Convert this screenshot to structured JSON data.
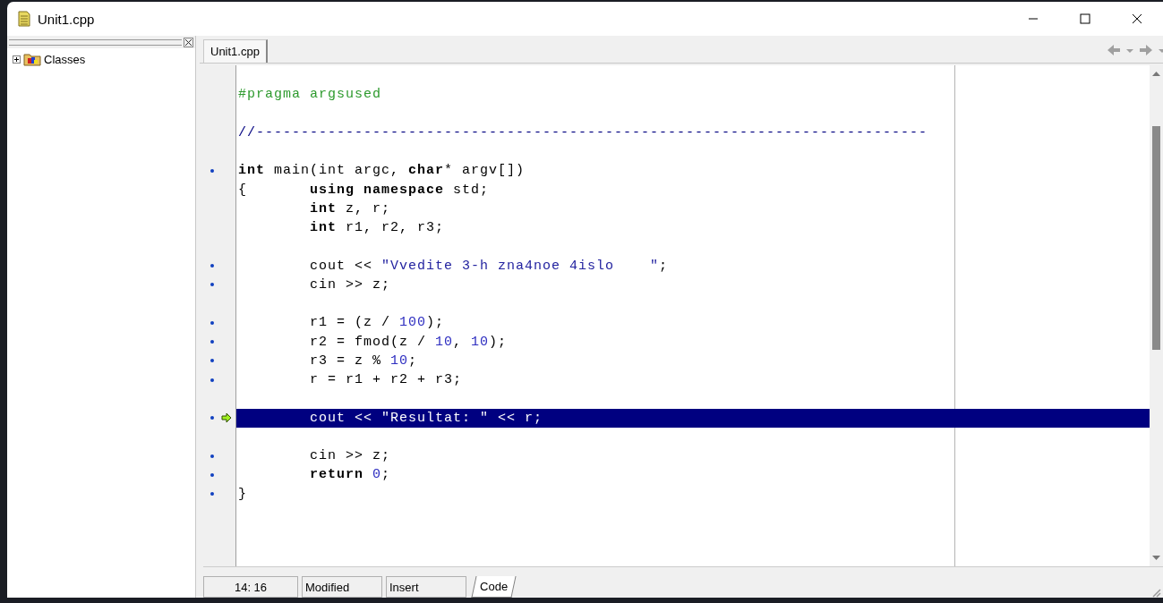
{
  "window": {
    "title": "Unit1.cpp"
  },
  "class_tree": {
    "items": [
      {
        "label": "Classes",
        "expanded": false
      }
    ]
  },
  "editor": {
    "tabs": [
      {
        "label": "Unit1.cpp",
        "selected": true
      }
    ],
    "lines": [
      {
        "dot": false,
        "current": false
      },
      {
        "dot": false,
        "current": false,
        "tokens": [
          {
            "kind": "directive",
            "text": "#pragma argsused"
          }
        ]
      },
      {
        "dot": false,
        "current": false
      },
      {
        "dot": false,
        "current": false,
        "tokens": [
          {
            "kind": "comment",
            "text": "//---------------------------------------------------------------------------"
          }
        ]
      },
      {
        "dot": false,
        "current": false
      },
      {
        "dot": true,
        "current": false,
        "tokens": [
          {
            "kind": "keyword",
            "text": "int"
          },
          {
            "kind": "text",
            "text": " main(int argc, "
          },
          {
            "kind": "keyword",
            "text": "char"
          },
          {
            "kind": "text",
            "text": "* argv[])"
          }
        ]
      },
      {
        "dot": false,
        "current": false,
        "tokens": [
          {
            "kind": "text",
            "text": "{       "
          },
          {
            "kind": "keyword",
            "text": "using namespace"
          },
          {
            "kind": "text",
            "text": " std;"
          }
        ]
      },
      {
        "dot": false,
        "current": false,
        "tokens": [
          {
            "kind": "keyword",
            "text": "        int"
          },
          {
            "kind": "text",
            "text": " z, r;"
          }
        ]
      },
      {
        "dot": false,
        "current": false,
        "tokens": [
          {
            "kind": "keyword",
            "text": "        int"
          },
          {
            "kind": "text",
            "text": " r1, r2, r3;"
          }
        ]
      },
      {
        "dot": false,
        "current": false
      },
      {
        "dot": true,
        "current": false,
        "tokens": [
          {
            "kind": "text",
            "text": "        cout << "
          },
          {
            "kind": "string",
            "text": "\"Vvedite 3-h zna4noe 4islo    \""
          },
          {
            "kind": "text",
            "text": ";"
          }
        ]
      },
      {
        "dot": true,
        "current": false,
        "tokens": [
          {
            "kind": "text",
            "text": "        cin >> z;"
          }
        ]
      },
      {
        "dot": false,
        "current": false
      },
      {
        "dot": true,
        "current": false,
        "tokens": [
          {
            "kind": "text",
            "text": "        r1 = (z / "
          },
          {
            "kind": "number",
            "text": "100"
          },
          {
            "kind": "text",
            "text": ");"
          }
        ]
      },
      {
        "dot": true,
        "current": false,
        "tokens": [
          {
            "kind": "text",
            "text": "        r2 = fmod(z / "
          },
          {
            "kind": "number",
            "text": "10"
          },
          {
            "kind": "text",
            "text": ", "
          },
          {
            "kind": "number",
            "text": "10"
          },
          {
            "kind": "text",
            "text": ");"
          }
        ]
      },
      {
        "dot": true,
        "current": false,
        "tokens": [
          {
            "kind": "text",
            "text": "        r3 = z % "
          },
          {
            "kind": "number",
            "text": "10"
          },
          {
            "kind": "text",
            "text": ";"
          }
        ]
      },
      {
        "dot": true,
        "current": false,
        "tokens": [
          {
            "kind": "text",
            "text": "        r = r1 + r2 + r3;"
          }
        ]
      },
      {
        "dot": false,
        "current": false
      },
      {
        "dot": true,
        "current": true,
        "tokens": [
          {
            "kind": "text",
            "text": "        cout << "
          },
          {
            "kind": "string",
            "text": "\"Resultat: \""
          },
          {
            "kind": "text",
            "text": " << r;"
          }
        ]
      },
      {
        "dot": false,
        "current": false
      },
      {
        "dot": true,
        "current": false,
        "tokens": [
          {
            "kind": "text",
            "text": "        cin >> z;"
          }
        ]
      },
      {
        "dot": true,
        "current": false,
        "tokens": [
          {
            "kind": "keyword",
            "text": "        return"
          },
          {
            "kind": "number",
            "text": " 0"
          },
          {
            "kind": "text",
            "text": ";"
          }
        ]
      },
      {
        "dot": true,
        "current": false,
        "tokens": [
          {
            "kind": "text",
            "text": "}"
          }
        ]
      }
    ]
  },
  "status_bar": {
    "position": "14: 16",
    "state": "Modified",
    "mode": "Insert",
    "tabs": [
      {
        "label": "Code",
        "selected": true
      }
    ]
  }
}
